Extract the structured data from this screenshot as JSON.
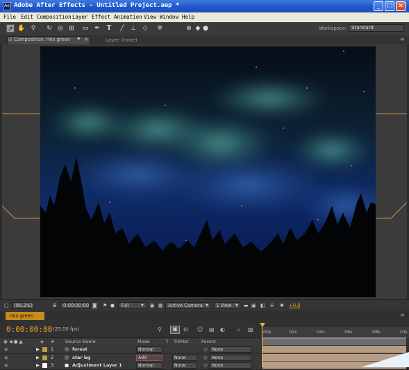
{
  "window": {
    "title": "Adobe After Effects - Untitled Project.aep *",
    "app_icon_text": "Ae",
    "buttons": {
      "minimize": "_",
      "maximize": "□",
      "close": "✕"
    }
  },
  "menu": [
    "File",
    "Edit",
    "Composition",
    "Layer",
    "Effect",
    "Animation",
    "View",
    "Window",
    "Help"
  ],
  "toolbar": {
    "tool_icons": [
      "selection-tool",
      "hand-tool",
      "zoom-tool",
      "rotation-tool",
      "camera-orbit-tool",
      "pan-behind-tool",
      "rectangle-mask-tool",
      "pen-tool",
      "type-tool",
      "brush-tool",
      "clone-stamp-tool",
      "eraser-tool",
      "puppet-tool"
    ],
    "workspace_label": "Workspace:",
    "workspace_value": "Standard"
  },
  "comp_panel": {
    "tab_label": "Composition: mix green",
    "layer_tab_label": "Layer: (none)"
  },
  "viewer": {
    "magnification": "(96.2%)",
    "timecode": "0:00:00:00",
    "resolution": "Full",
    "camera": "Active Camera",
    "views": "1 View",
    "exposure": "+0.0"
  },
  "timeline": {
    "tab_label": "mix green",
    "timecode": "0:00:00:00",
    "fps": "(25.00 fps)",
    "columns": {
      "number": "#",
      "source_name": "Source Name",
      "mode": "Mode",
      "t": "T",
      "trkmat": "TrkMat",
      "parent": "Parent"
    },
    "ruler_ticks": [
      "00s",
      "02s",
      "04s",
      "06s",
      "08s",
      "10s"
    ],
    "layers": [
      {
        "num": "1",
        "name": "forest",
        "mode": "Normal",
        "trkmat": "",
        "parent": "None",
        "color": "#b89c4a"
      },
      {
        "num": "2",
        "name": "star bg",
        "mode": "Add",
        "trkmat": "None",
        "parent": "None",
        "color": "#b89c4a"
      },
      {
        "num": "3",
        "name": "Adjustment Layer 1",
        "mode": "Normal",
        "trkmat": "None",
        "parent": "None",
        "color": "#ffffff"
      }
    ]
  },
  "colors": {
    "accent_orange": "#f0a020",
    "titlebar_blue": "#2a5fd6"
  }
}
